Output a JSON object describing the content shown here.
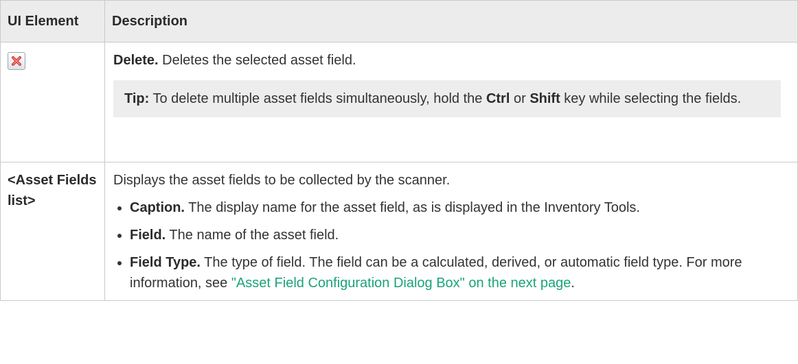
{
  "table": {
    "header": {
      "col1": "UI Element",
      "col2": "Description"
    },
    "rows": [
      {
        "element_icon": "delete-red-x-icon",
        "title": "Delete.",
        "desc": " Deletes the selected asset field.",
        "tip": {
          "label": "Tip:",
          "text_1": " To delete multiple asset fields simultaneously, hold the ",
          "key_1": "Ctrl",
          "text_2": " or ",
          "key_2": "Shift",
          "text_3": " key while selecting the fields."
        }
      },
      {
        "element_label": "<Asset Fields list>",
        "intro": "Displays the asset fields to be collected by the scanner.",
        "items": [
          {
            "term": "Caption.",
            "text": " The display name for the asset field, as is displayed in the Inventory Tools."
          },
          {
            "term": "Field.",
            "text": " The name of the asset field."
          },
          {
            "term": "Field Type.",
            "text": " The type of field. The field can be a calculated, derived, or automatic field type. For more information, see ",
            "link": "\"Asset Field Configuration Dialog Box\" on the next page",
            "end": "."
          }
        ]
      }
    ]
  },
  "colors": {
    "link": "#1aa37a",
    "header_bg": "#ececec",
    "tip_bg": "#ededed",
    "delete_icon": "#d9342b"
  }
}
